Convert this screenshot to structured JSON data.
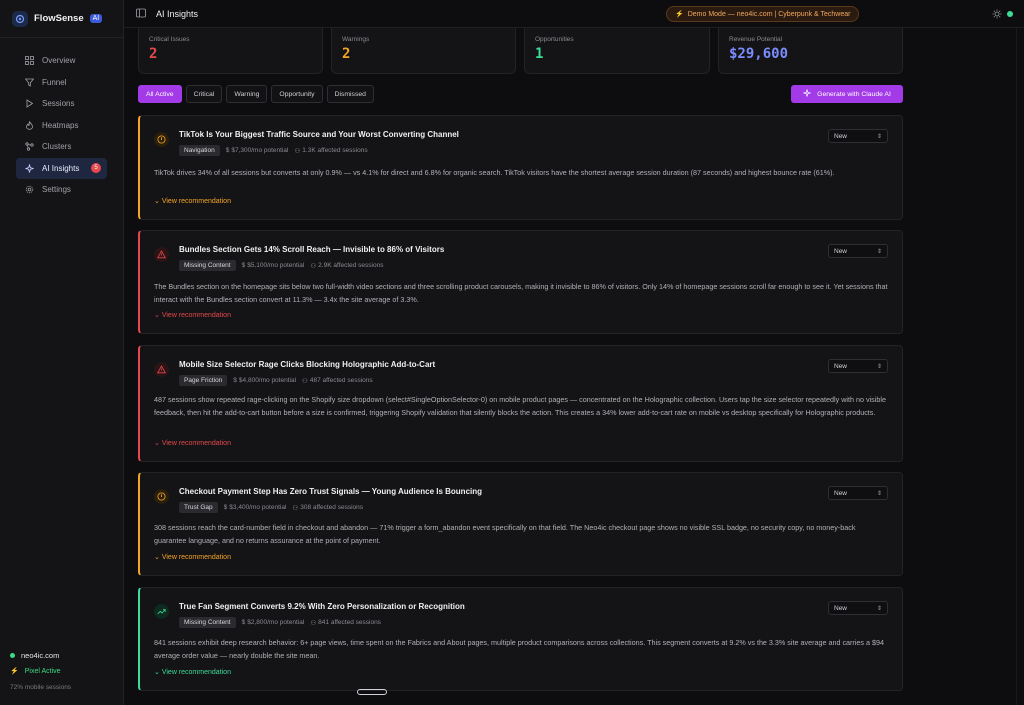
{
  "brand": {
    "name": "FlowSense",
    "badge": "AI"
  },
  "nav": [
    {
      "label": "Overview",
      "icon": "grid-icon",
      "active": false
    },
    {
      "label": "Funnel",
      "icon": "funnel-icon",
      "active": false
    },
    {
      "label": "Sessions",
      "icon": "play-icon",
      "active": false
    },
    {
      "label": "Heatmaps",
      "icon": "flame-icon",
      "active": false
    },
    {
      "label": "Clusters",
      "icon": "cluster-icon",
      "active": false
    },
    {
      "label": "AI Insights",
      "icon": "sparkle-icon",
      "active": true,
      "badge": "5"
    },
    {
      "label": "Settings",
      "icon": "gear-icon",
      "active": false
    }
  ],
  "site": {
    "domain": "neo4ic.com",
    "pixel": "Pixel Active",
    "mobile": "72% mobile sessions"
  },
  "header": {
    "title": "AI Insights",
    "demo": "Demo Mode — neo4ic.com | Cyberpunk & Techwear"
  },
  "stats": [
    {
      "label": "Critical Issues",
      "value": "2",
      "color": "#e5484d"
    },
    {
      "label": "Warnings",
      "value": "2",
      "color": "#f5a524"
    },
    {
      "label": "Opportunities",
      "value": "1",
      "color": "#3ddc97"
    },
    {
      "label": "Revenue Potential",
      "value": "$29,600",
      "color": "#7b8cff"
    }
  ],
  "filters": [
    "All Active",
    "Critical",
    "Warning",
    "Opportunity",
    "Dismissed"
  ],
  "generate_label": "Generate with Claude AI",
  "view_label": "View recommendation",
  "insights": [
    {
      "title": "TikTok Is Your Biggest Traffic Source and Your Worst Converting Channel",
      "tag": "Navigation",
      "potential": "$7,300/mo potential",
      "sessions": "1.3K affected sessions",
      "desc": "TikTok drives 34% of all sessions but converts at only 0.9% — vs 4.1% for direct and 6.8% for organic search. TikTok visitors have the shortest average session duration (87 seconds) and highest bounce rate (61%).",
      "status": "New",
      "severity": "warning",
      "color": "#f5a524"
    },
    {
      "title": "Bundles Section Gets 14% Scroll Reach — Invisible to 86% of Visitors",
      "tag": "Missing Content",
      "potential": "$5,100/mo potential",
      "sessions": "2.9K affected sessions",
      "desc": "The Bundles section on the homepage sits below two full-width video sections and three scrolling product carousels, making it invisible to 86% of visitors. Only 14% of homepage sessions scroll far enough to see it. Yet sessions that interact with the Bundles section convert at 11.3% — 3.4x the site average of 3.3%.",
      "status": "New",
      "severity": "critical",
      "color": "#e5484d"
    },
    {
      "title": "Mobile Size Selector Rage Clicks Blocking Holographic Add-to-Cart",
      "tag": "Page Friction",
      "potential": "$4,800/mo potential",
      "sessions": "487 affected sessions",
      "desc": "487 sessions show repeated rage-clicking on the Shopify size dropdown (select#SingleOptionSelector-0) on mobile product pages — concentrated on the Holographic collection. Users tap the size selector repeatedly with no visible feedback, then hit the add-to-cart button before a size is confirmed, triggering Shopify validation that silently blocks the action. This creates a 34% lower add-to-cart rate on mobile vs desktop specifically for Holographic products.",
      "status": "New",
      "severity": "critical",
      "color": "#e5484d"
    },
    {
      "title": "Checkout Payment Step Has Zero Trust Signals — Young Audience Is Bouncing",
      "tag": "Trust Gap",
      "potential": "$3,400/mo potential",
      "sessions": "308 affected sessions",
      "desc": "308 sessions reach the card-number field in checkout and abandon — 71% trigger a form_abandon event specifically on that field. The Neo4ic checkout page shows no visible SSL badge, no security copy, no money-back guarantee language, and no returns assurance at the point of payment.",
      "status": "New",
      "severity": "warning",
      "color": "#f5a524"
    },
    {
      "title": "True Fan Segment Converts 9.2% With Zero Personalization or Recognition",
      "tag": "Missing Content",
      "potential": "$2,800/mo potential",
      "sessions": "841 affected sessions",
      "desc": "841 sessions exhibit deep research behavior: 6+ page views, time spent on the Fabrics and About pages, multiple product comparisons across collections. This segment converts at 9.2% vs the 3.3% site average and carries a $94 average order value — nearly double the site mean.",
      "status": "New",
      "severity": "opportunity",
      "color": "#3ddc97"
    }
  ]
}
